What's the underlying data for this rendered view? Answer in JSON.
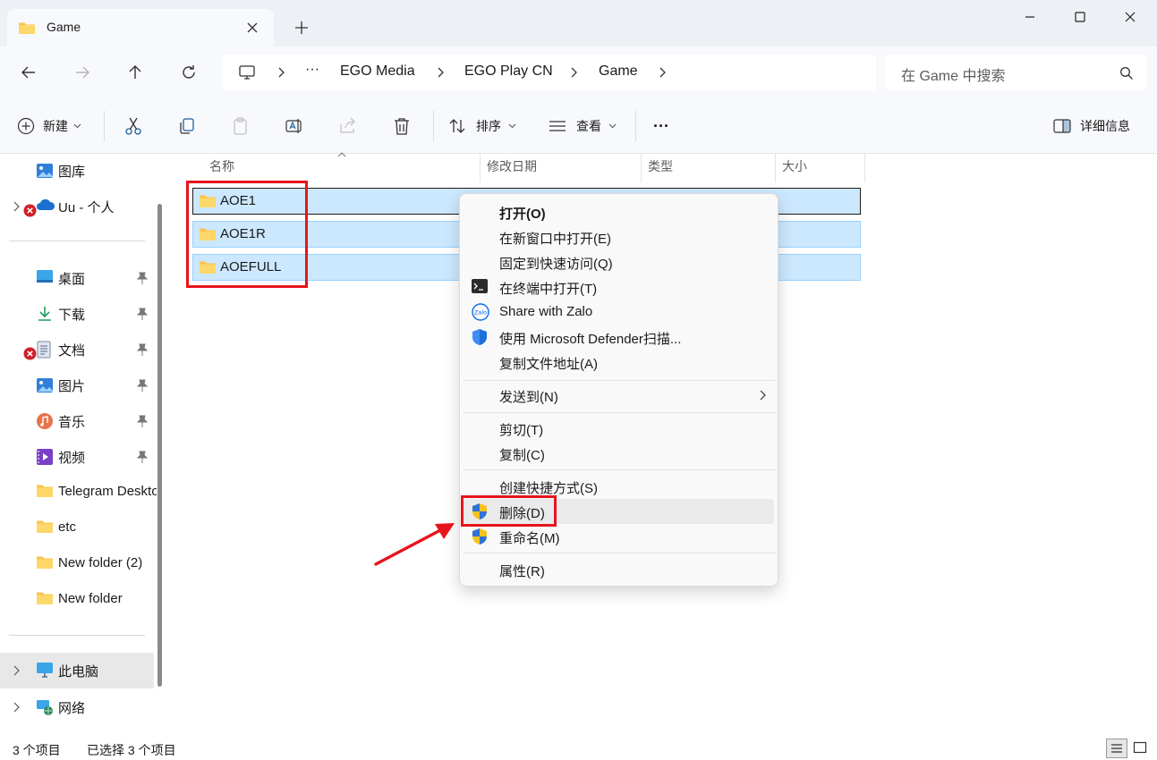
{
  "window": {
    "tab_title": "Game",
    "new_tab": "+",
    "icons": {
      "folder": "folder-icon",
      "close": "close-icon",
      "min": "minimize-icon",
      "max": "maximize-icon"
    }
  },
  "address": {
    "ellipsis": "···",
    "crumbs": [
      "EGO Media",
      "EGO Play CN",
      "Game"
    ],
    "search_placeholder": "在 Game 中搜索"
  },
  "toolbar": {
    "new_label": "新建",
    "sort_label": "排序",
    "view_label": "查看",
    "more_label": "···",
    "details_label": "详细信息"
  },
  "sidebar": {
    "top": [
      {
        "label": "图库"
      },
      {
        "label": "Uu - 个人"
      }
    ],
    "quick": [
      {
        "label": "桌面"
      },
      {
        "label": "下载"
      },
      {
        "label": "文档"
      },
      {
        "label": "图片"
      },
      {
        "label": "音乐"
      },
      {
        "label": "视频"
      },
      {
        "label": "Telegram Desktop"
      },
      {
        "label": "etc"
      },
      {
        "label": "New folder (2)"
      },
      {
        "label": "New folder"
      }
    ],
    "bottom": [
      {
        "label": "此电脑"
      },
      {
        "label": "网络"
      }
    ]
  },
  "columns": [
    "名称",
    "修改日期",
    "类型",
    "大小"
  ],
  "files": [
    {
      "name": "AOE1"
    },
    {
      "name": "AOE1R"
    },
    {
      "name": "AOEFULL"
    }
  ],
  "context_menu": {
    "items": [
      {
        "label": "打开(O)"
      },
      {
        "label": "在新窗口中打开(E)"
      },
      {
        "label": "固定到快速访问(Q)"
      },
      {
        "label": "在终端中打开(T)"
      },
      {
        "label": "Share with Zalo"
      },
      {
        "label": "使用 Microsoft Defender扫描..."
      },
      {
        "label": "复制文件地址(A)"
      },
      {
        "label": "发送到(N)"
      },
      {
        "label": "剪切(T)"
      },
      {
        "label": "复制(C)"
      },
      {
        "label": "创建快捷方式(S)"
      },
      {
        "label": "删除(D)"
      },
      {
        "label": "重命名(M)"
      },
      {
        "label": "属性(R)"
      }
    ],
    "zalo_icon_text": "Zalo"
  },
  "status": {
    "count": "3 个项目",
    "selected": "已选择 3 个项目"
  },
  "colors": {
    "accent": "#0067c0",
    "selection": "#cce8ff",
    "annotation": "#e8141c"
  }
}
